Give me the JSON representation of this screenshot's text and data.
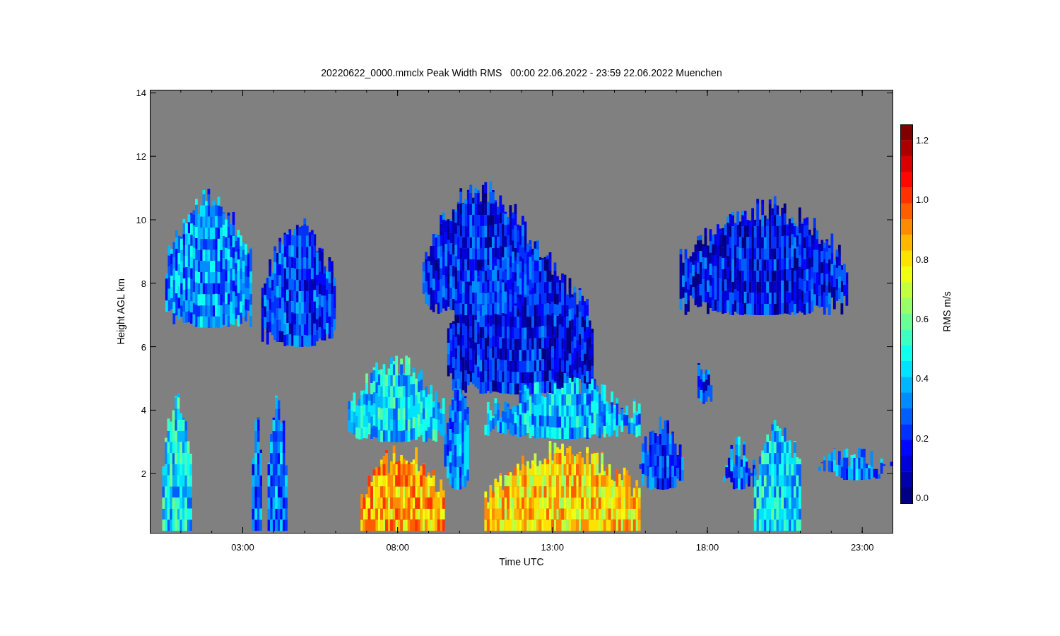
{
  "title": "20220622_0000.mmclx Peak Width RMS   00:00 22.06.2022 - 23:59 22.06.2022 Muenchen",
  "x_axis": {
    "label": "Time UTC",
    "ticks": [
      "03:00",
      "08:00",
      "13:00",
      "18:00",
      "23:00"
    ]
  },
  "y_axis": {
    "label": "Height AGL km",
    "ticks": [
      "14",
      "12",
      "10",
      "8",
      "6",
      "4",
      "2"
    ]
  },
  "colorbar": {
    "label": "RMS m/s",
    "ticks": [
      "1.2",
      "1.0",
      "0.8",
      "0.6",
      "0.4",
      "0.2",
      "0.0"
    ]
  }
}
